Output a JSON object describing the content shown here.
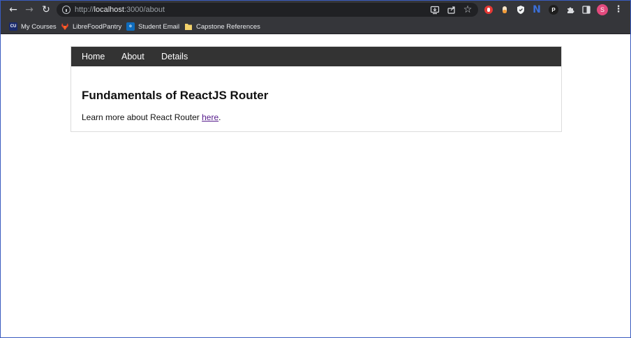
{
  "browser": {
    "url_prefix": "http://",
    "url_host": "localhost",
    "url_rest": ":3000/about",
    "profile_initial": "S",
    "colors": {
      "chrome": "#35363a",
      "omnibox": "#202124",
      "avatar": "#e24a7d"
    }
  },
  "bookmarks": [
    {
      "label": "My Courses",
      "icon": "cu-favicon"
    },
    {
      "label": "LibreFoodPantry",
      "icon": "gitlab-fox-icon"
    },
    {
      "label": "Student Email",
      "icon": "outlook-icon"
    },
    {
      "label": "Capstone References",
      "icon": "folder-icon"
    }
  ],
  "app": {
    "nav": [
      "Home",
      "About",
      "Details"
    ],
    "title": "Fundamentals of ReactJS Router",
    "paragraph_before": "Learn more about React Router ",
    "paragraph_link": "here",
    "paragraph_after": ".",
    "navbar_color": "#333333"
  }
}
